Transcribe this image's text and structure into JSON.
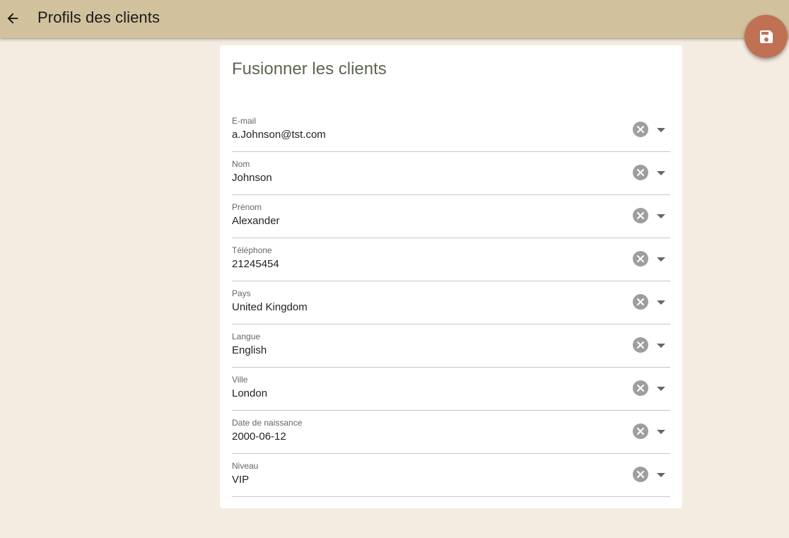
{
  "header": {
    "title": "Profils des clients",
    "back_icon": "arrow-left-icon"
  },
  "card": {
    "title": "Fusionner les clients",
    "fields": [
      {
        "label": "E-mail",
        "value": "a.Johnson@tst.com"
      },
      {
        "label": "Nom",
        "value": "Johnson"
      },
      {
        "label": "Prénom",
        "value": "Alexander"
      },
      {
        "label": "Téléphone",
        "value": "21245454"
      },
      {
        "label": "Pays",
        "value": "United Kingdom"
      },
      {
        "label": "Langue",
        "value": "English"
      },
      {
        "label": "Ville",
        "value": "London"
      },
      {
        "label": "Date de naissance",
        "value": "2000-06-12"
      },
      {
        "label": "Niveau",
        "value": "VIP"
      }
    ]
  },
  "save_fab": {
    "icon": "floppy-disk-icon"
  },
  "colors": {
    "app_bar": "#d1c19d",
    "background": "#f4ebe1",
    "fab": "#c07154",
    "card_title": "#5d6651"
  }
}
